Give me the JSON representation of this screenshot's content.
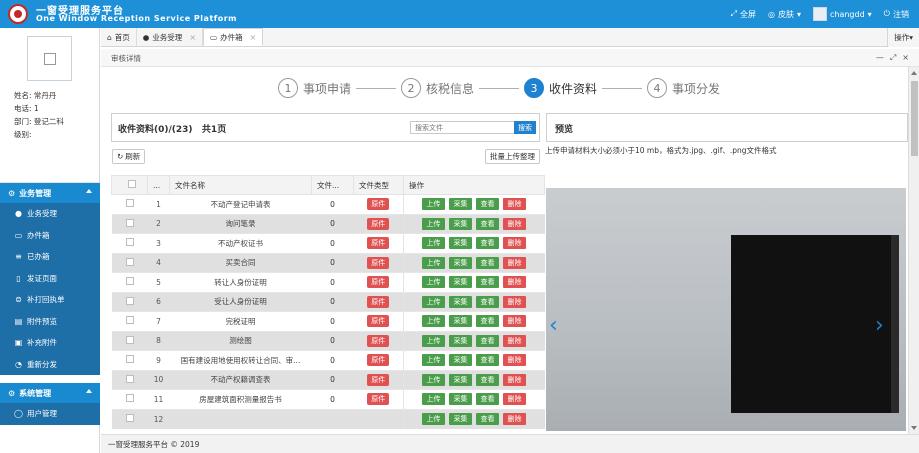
{
  "header": {
    "title": "一窗受理服务平台",
    "subtitle": "One Window Reception Service Platform",
    "fullscreen": "全屏",
    "skin": "皮肤",
    "username": "changdd",
    "logout": "注销"
  },
  "profile": {
    "name": "姓名: 常丹丹",
    "phone": "电话: 1",
    "dept": "部门: 登记二科",
    "level": "级别:"
  },
  "sidebar": {
    "group1": {
      "title": "业务管理",
      "items": [
        {
          "label": "业务受理",
          "icon": "globe-icon",
          "glyph": "●"
        },
        {
          "label": "办件箱",
          "icon": "inbox-icon",
          "glyph": "▭"
        },
        {
          "label": "已办箱",
          "icon": "menu-icon",
          "glyph": "≡"
        },
        {
          "label": "发证页面",
          "icon": "document-icon",
          "glyph": "▯"
        },
        {
          "label": "补打回执单",
          "icon": "print-icon",
          "glyph": "⊜"
        },
        {
          "label": "附件预览",
          "icon": "preview-icon",
          "glyph": "▤"
        },
        {
          "label": "补充附件",
          "icon": "attach-icon",
          "glyph": "▣"
        },
        {
          "label": "重新分发",
          "icon": "redistribute-icon",
          "glyph": "◔"
        }
      ]
    },
    "group2": {
      "title": "系统管理",
      "items": [
        {
          "label": "用户管理",
          "icon": "user-icon",
          "glyph": "◯"
        }
      ]
    }
  },
  "tabs": [
    {
      "label": "首页",
      "glyph": "⌂"
    },
    {
      "label": "业务受理",
      "glyph": "●"
    },
    {
      "label": "办件箱",
      "glyph": "▭"
    }
  ],
  "tab_ops": "操作",
  "subheader": {
    "title": "审核详情"
  },
  "steps": [
    {
      "num": "1",
      "label": "事项申请"
    },
    {
      "num": "2",
      "label": "核税信息"
    },
    {
      "num": "3",
      "label": "收件资料"
    },
    {
      "num": "4",
      "label": "事项分发"
    }
  ],
  "files": {
    "title": "收件资料(0)/(23)   共1页",
    "search_placeholder": "搜索文件",
    "search_button": "搜索",
    "refresh": "刷新",
    "batch_upload": "批量上传整理",
    "columns": {
      "no": "...",
      "name": "文件名称",
      "count": "文件...",
      "type": "文件类型",
      "ops": "操作"
    },
    "ops_labels": {
      "upload": "上传",
      "collect": "采集",
      "view": "查看",
      "delete": "删除"
    },
    "rows": [
      {
        "no": "1",
        "name": "不动产登记申请表",
        "count": "0",
        "type": "原件"
      },
      {
        "no": "2",
        "name": "询问笔录",
        "count": "0",
        "type": "原件"
      },
      {
        "no": "3",
        "name": "不动产权证书",
        "count": "0",
        "type": "原件"
      },
      {
        "no": "4",
        "name": "买卖合同",
        "count": "0",
        "type": "原件"
      },
      {
        "no": "5",
        "name": "转让人身份证明",
        "count": "0",
        "type": "原件"
      },
      {
        "no": "6",
        "name": "受让人身份证明",
        "count": "0",
        "type": "原件"
      },
      {
        "no": "7",
        "name": "完税证明",
        "count": "0",
        "type": "原件"
      },
      {
        "no": "8",
        "name": "测绘图",
        "count": "0",
        "type": "原件"
      },
      {
        "no": "9",
        "name": "国有建设用地使用权转让合同、审...",
        "count": "0",
        "type": "原件"
      },
      {
        "no": "10",
        "name": "不动产权籍调查表",
        "count": "0",
        "type": "原件"
      },
      {
        "no": "11",
        "name": "房屋建筑面积测量报告书",
        "count": "0",
        "type": "原件"
      },
      {
        "no": "12",
        "name": "",
        "count": "",
        "type": ""
      }
    ]
  },
  "preview": {
    "title": "预览",
    "hint": "上传申请材料大小必须小于10 mb，格式为.jpg、.gif、.png文件格式",
    "prev": "‹",
    "next": "›"
  },
  "footer": "一窗受理服务平台 © 2019",
  "colors": {
    "primary": "#1e90d8",
    "sidebar_dark": "#1e6ea8",
    "green": "#4a9d4a",
    "red": "#e05252"
  }
}
